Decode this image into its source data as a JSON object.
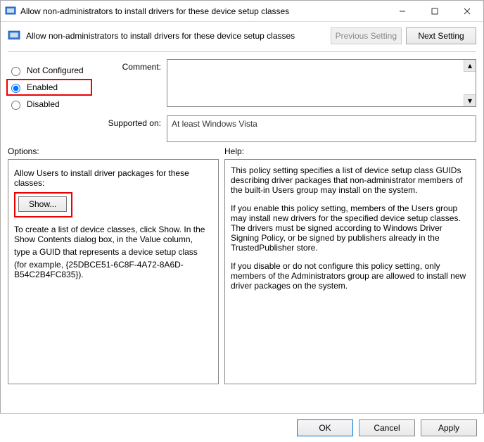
{
  "window": {
    "title": "Allow non-administrators to install drivers for these device setup classes"
  },
  "header": {
    "policy_name": "Allow non-administrators to install drivers for these device setup classes",
    "prev_setting": "Previous Setting",
    "next_setting": "Next Setting"
  },
  "state": {
    "not_configured": "Not Configured",
    "enabled": "Enabled",
    "disabled": "Disabled",
    "selected": "enabled"
  },
  "labels": {
    "comment": "Comment:",
    "supported_on": "Supported on:",
    "options": "Options:",
    "help": "Help:"
  },
  "supported_text": "At least Windows Vista",
  "options_panel": {
    "intro": "Allow Users to install driver packages for these classes:",
    "show_button": "Show...",
    "line1": "To create a list of device classes, click Show. In the Show Contents dialog box, in the Value column,",
    "line2": "type a GUID that represents a device setup class",
    "line3": "(for example, {25DBCE51-6C8F-4A72-8A6D-B54C2B4FC835})."
  },
  "help_panel": {
    "p1": "This policy setting specifies a list of device setup class GUIDs describing driver packages that non-administrator members of the built-in Users group may install on the system.",
    "p2": "If you enable this policy setting, members of the Users group may install new drivers for the specified device setup classes. The drivers must be signed according to Windows Driver Signing Policy, or be signed by publishers already in the TrustedPublisher store.",
    "p3": "If you disable or do not configure this policy setting, only members of the Administrators group are allowed to install new driver packages on the system."
  },
  "footer": {
    "ok": "OK",
    "cancel": "Cancel",
    "apply": "Apply"
  }
}
